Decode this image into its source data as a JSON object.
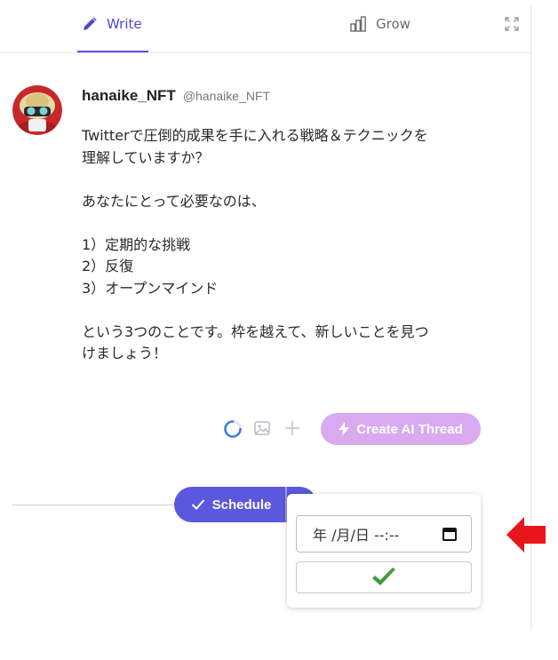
{
  "tabs": {
    "write_label": "Write",
    "grow_label": "Grow"
  },
  "tweet": {
    "author_name": "hanaike_NFT",
    "author_handle": "@hanaike_NFT",
    "text": "Twitterで圧倒的成果を手に入れる戦略＆テクニックを\n理解していますか？\n\nあなたにとって必要なのは、\n\n1）定期的な挑戦\n2）反復\n3）オープンマインド\n\nという3つのことです。枠を越えて、新しいことを見つ\nけましょう！"
  },
  "toolbar": {
    "ai_thread_label": "Create AI Thread"
  },
  "schedule": {
    "label": "Schedule"
  },
  "datetime_picker": {
    "display": "年 /月/日  --:--"
  },
  "colors": {
    "accent": "#5c58dd",
    "ai_button": "#d9aaf0",
    "confirm_check": "#3f9a3f",
    "annotation_arrow": "#e8161c"
  },
  "icons": {
    "write": "pencil-icon",
    "grow": "bar-chart-icon",
    "expand": "expand-icon",
    "loading": "spinner-icon",
    "image": "image-icon",
    "plus": "plus-icon",
    "ai": "lightning-icon",
    "schedule": "check-icon",
    "calendar": "calendar-icon",
    "confirm": "checkmark-icon",
    "annotation": "red-arrow-icon"
  }
}
